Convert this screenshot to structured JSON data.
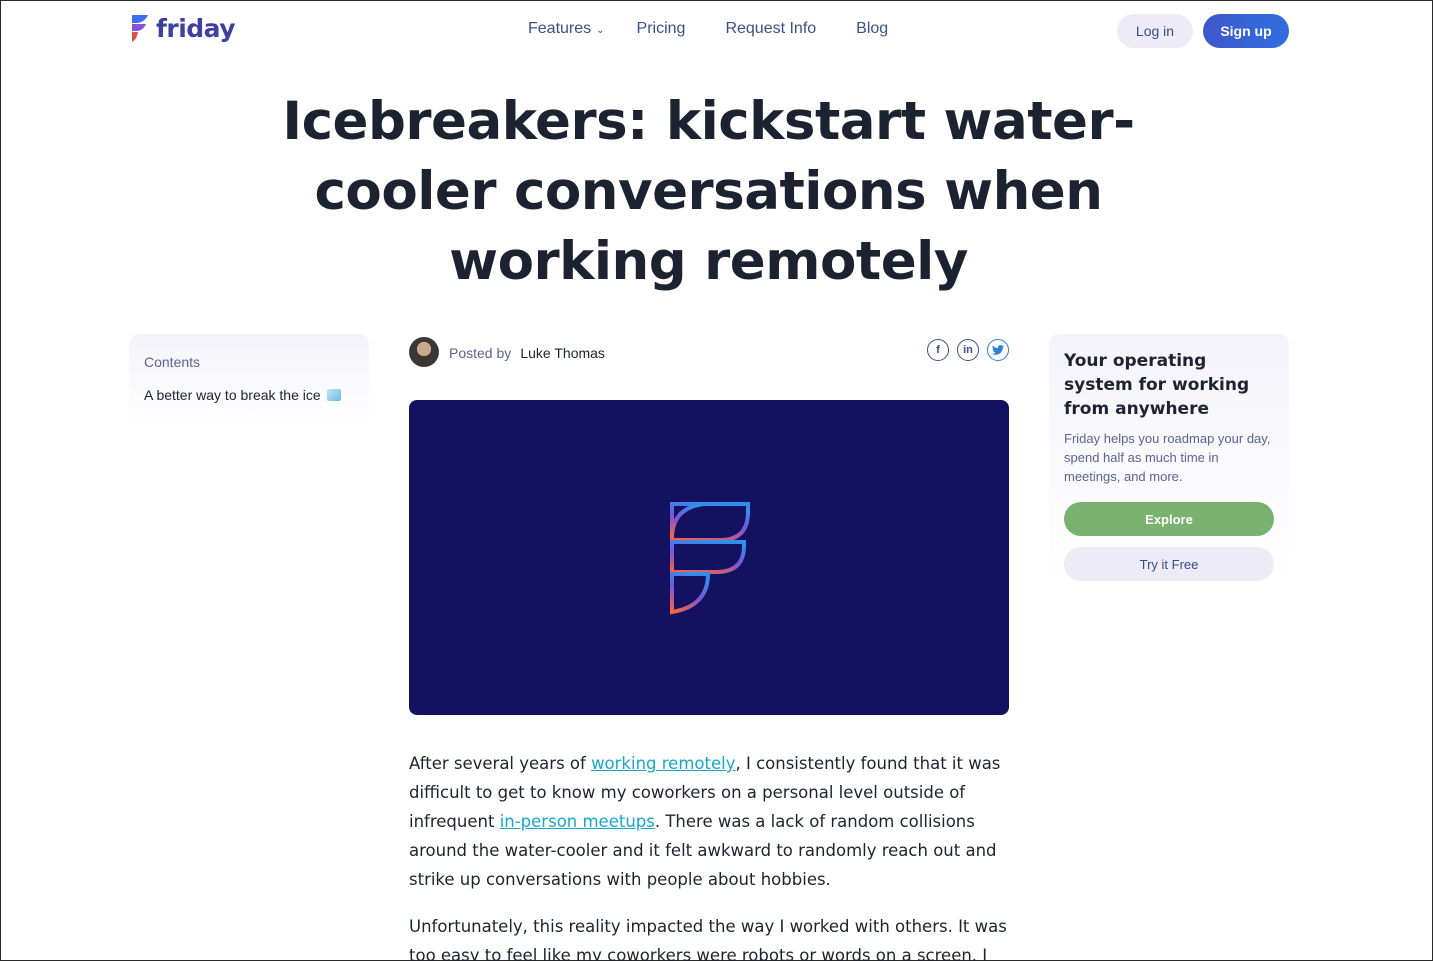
{
  "header": {
    "brand": "friday",
    "nav": [
      {
        "label": "Features"
      },
      {
        "label": "Pricing"
      },
      {
        "label": "Request Info"
      },
      {
        "label": "Blog"
      }
    ],
    "login_label": "Log in",
    "signup_label": "Sign up"
  },
  "article": {
    "title": "Icebreakers: kickstart water-cooler conversations when working remotely",
    "posted_by_label": "Posted by",
    "author": "Luke Thomas",
    "paragraph1": {
      "t1": "After several years of ",
      "link1": "working remotely",
      "t2": ", I consistently found that it was difficult to get to know my coworkers on a personal level outside of infrequent ",
      "link2": "in-person meetups",
      "t3": ". There was a lack of random collisions around the water-cooler and it felt awkward to randomly reach out and strike up conversations with people about hobbies."
    },
    "paragraph2": "Unfortunately, this reality impacted the way I worked with others. It was too easy to feel like my coworkers were robots or words on a screen. I"
  },
  "toc": {
    "label": "Contents",
    "items": [
      {
        "label": "A better way to break the ice"
      }
    ]
  },
  "share": {
    "icons": [
      "facebook-icon",
      "linkedin-icon",
      "twitter-icon"
    ]
  },
  "cta": {
    "title": "Your operating system for working from anywhere",
    "description": "Friday helps you roadmap your day, spend half as much time in meetings, and more.",
    "explore_label": "Explore",
    "try_label": "Try it Free"
  },
  "colors": {
    "brand": "#3f3f9f",
    "hero_bg": "#141160",
    "link": "#18a7c9",
    "explore": "#78b26e"
  }
}
